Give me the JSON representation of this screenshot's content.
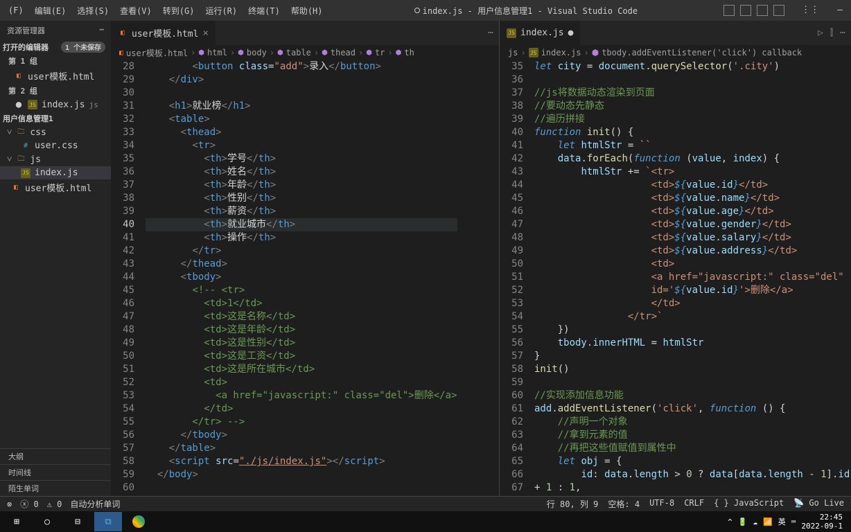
{
  "menu": [
    "(F)",
    "编辑(E)",
    "选择(S)",
    "查看(V)",
    "转到(G)",
    "运行(R)",
    "终端(T)",
    "帮助(H)"
  ],
  "window_title": "index.js - 用户信息管理1 - Visual Studio Code",
  "sidebar": {
    "title": "资源管理器",
    "section_open": "打开的编辑器",
    "badge_unsaved": "1 个未保存",
    "group1": "第 1 组",
    "group2": "第 2 组",
    "file_html": "user模板.html",
    "file_indexjs": "index.js",
    "file_indexjs_path": "js",
    "project": "用户信息管理1",
    "folder_css": "css",
    "file_usercss": "user.css",
    "folder_js": "js",
    "outline": "大纲",
    "timeline": "时间线",
    "strange": "陌生单词"
  },
  "editor1": {
    "tab": "user模板.html",
    "breadcrumb": [
      "user模板.html",
      "html",
      "body",
      "table",
      "thead",
      "tr",
      "th"
    ],
    "lines_start": 28,
    "current_line": 40
  },
  "editor2": {
    "tab": "index.js",
    "breadcrumb": [
      "js",
      "index.js",
      "tbody.addEventListener('click') callback"
    ],
    "lines_start": 35
  },
  "status": {
    "errors": "0",
    "warnings": "0",
    "auto": "自动分析单词",
    "pos": "行 80, 列 9",
    "spaces": "空格: 4",
    "encoding": "UTF-8",
    "eol": "CRLF",
    "lang": "{ } JavaScript",
    "golive": "Go Live"
  },
  "taskbar": {
    "time": "22:45",
    "date": "2022-09-1",
    "ime": "英"
  },
  "chart_data": null
}
